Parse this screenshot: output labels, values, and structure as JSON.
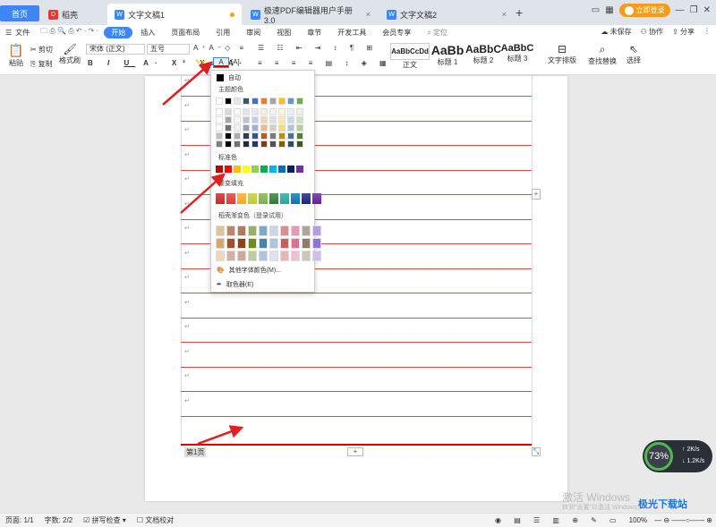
{
  "tabs": {
    "home": "首页",
    "t1": "稻壳",
    "t2": "文字文稿1",
    "t3": "极速PDF编辑器用户手册3.0",
    "t4": "文字文稿2"
  },
  "top_right": {
    "login": "立即登录"
  },
  "menu": {
    "file": "文件",
    "items": [
      "开始",
      "插入",
      "页面布局",
      "引用",
      "审阅",
      "视图",
      "章节",
      "开发工具",
      "会员专享",
      "定位"
    ],
    "right": [
      "未保存",
      "协作",
      "分享"
    ]
  },
  "toolbar": {
    "paste": "粘贴",
    "cut": "剪切",
    "copy": "复制",
    "format_painter": "格式刷",
    "font": "宋体 (正文)",
    "size": "五号",
    "styles": [
      {
        "preview": "AaBbCcDd",
        "name": "正文"
      },
      {
        "preview": "AaBb",
        "name": "标题 1"
      },
      {
        "preview": "AaBbC",
        "name": "标题 2"
      },
      {
        "preview": "AaBbC",
        "name": "标题 3"
      }
    ],
    "text_layout": "文字排版",
    "find_replace": "查找替换",
    "select": "选择"
  },
  "color_popup": {
    "auto": "自动",
    "theme": "主题颜色",
    "standard": "标准色",
    "gradient": "渐变填充",
    "docer_gradient": "稻壳渐变色（登录试用）",
    "more": "其他字体颜色(M)...",
    "picker": "取色器(E)",
    "theme_top": [
      "#ffffff",
      "#000000",
      "#e7e6e6",
      "#44546a",
      "#4472c4",
      "#ed7d31",
      "#a5a5a5",
      "#ffc000",
      "#5b9bd5",
      "#70ad47"
    ],
    "standard_colors": [
      "#c00000",
      "#ff0000",
      "#ffc000",
      "#ffff00",
      "#92d050",
      "#00b050",
      "#00b0f0",
      "#0070c0",
      "#002060",
      "#7030a0"
    ],
    "gradient_colors": [
      "#c62828",
      "#e53935",
      "#f9a825",
      "#c0ca33",
      "#7cb342",
      "#2e7d32",
      "#26a69a",
      "#0277bd",
      "#1a237e",
      "#6a1b9a"
    ]
  },
  "document": {
    "footer_label": "第1页"
  },
  "status": {
    "page": "页面: 1/1",
    "words": "字数: 2/2",
    "spell": "拼写检查",
    "proof": "文档校对",
    "zoom": "100%"
  },
  "speed": {
    "percent": "73%",
    "up": "2K/s",
    "down": "1.2K/s"
  },
  "watermark": {
    "line1": "激活 Windows",
    "line2": "转到\"设置\"以激活 Windows。",
    "site": "极光下载站"
  }
}
